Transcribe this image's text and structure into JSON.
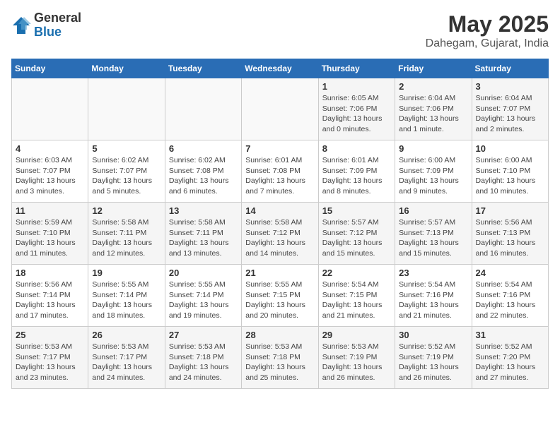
{
  "logo": {
    "general": "General",
    "blue": "Blue"
  },
  "header": {
    "month": "May 2025",
    "location": "Dahegam, Gujarat, India"
  },
  "weekdays": [
    "Sunday",
    "Monday",
    "Tuesday",
    "Wednesday",
    "Thursday",
    "Friday",
    "Saturday"
  ],
  "weeks": [
    [
      {
        "day": "",
        "info": ""
      },
      {
        "day": "",
        "info": ""
      },
      {
        "day": "",
        "info": ""
      },
      {
        "day": "",
        "info": ""
      },
      {
        "day": "1",
        "info": "Sunrise: 6:05 AM\nSunset: 7:06 PM\nDaylight: 13 hours\nand 0 minutes."
      },
      {
        "day": "2",
        "info": "Sunrise: 6:04 AM\nSunset: 7:06 PM\nDaylight: 13 hours\nand 1 minute."
      },
      {
        "day": "3",
        "info": "Sunrise: 6:04 AM\nSunset: 7:07 PM\nDaylight: 13 hours\nand 2 minutes."
      }
    ],
    [
      {
        "day": "4",
        "info": "Sunrise: 6:03 AM\nSunset: 7:07 PM\nDaylight: 13 hours\nand 3 minutes."
      },
      {
        "day": "5",
        "info": "Sunrise: 6:02 AM\nSunset: 7:07 PM\nDaylight: 13 hours\nand 5 minutes."
      },
      {
        "day": "6",
        "info": "Sunrise: 6:02 AM\nSunset: 7:08 PM\nDaylight: 13 hours\nand 6 minutes."
      },
      {
        "day": "7",
        "info": "Sunrise: 6:01 AM\nSunset: 7:08 PM\nDaylight: 13 hours\nand 7 minutes."
      },
      {
        "day": "8",
        "info": "Sunrise: 6:01 AM\nSunset: 7:09 PM\nDaylight: 13 hours\nand 8 minutes."
      },
      {
        "day": "9",
        "info": "Sunrise: 6:00 AM\nSunset: 7:09 PM\nDaylight: 13 hours\nand 9 minutes."
      },
      {
        "day": "10",
        "info": "Sunrise: 6:00 AM\nSunset: 7:10 PM\nDaylight: 13 hours\nand 10 minutes."
      }
    ],
    [
      {
        "day": "11",
        "info": "Sunrise: 5:59 AM\nSunset: 7:10 PM\nDaylight: 13 hours\nand 11 minutes."
      },
      {
        "day": "12",
        "info": "Sunrise: 5:58 AM\nSunset: 7:11 PM\nDaylight: 13 hours\nand 12 minutes."
      },
      {
        "day": "13",
        "info": "Sunrise: 5:58 AM\nSunset: 7:11 PM\nDaylight: 13 hours\nand 13 minutes."
      },
      {
        "day": "14",
        "info": "Sunrise: 5:58 AM\nSunset: 7:12 PM\nDaylight: 13 hours\nand 14 minutes."
      },
      {
        "day": "15",
        "info": "Sunrise: 5:57 AM\nSunset: 7:12 PM\nDaylight: 13 hours\nand 15 minutes."
      },
      {
        "day": "16",
        "info": "Sunrise: 5:57 AM\nSunset: 7:13 PM\nDaylight: 13 hours\nand 15 minutes."
      },
      {
        "day": "17",
        "info": "Sunrise: 5:56 AM\nSunset: 7:13 PM\nDaylight: 13 hours\nand 16 minutes."
      }
    ],
    [
      {
        "day": "18",
        "info": "Sunrise: 5:56 AM\nSunset: 7:14 PM\nDaylight: 13 hours\nand 17 minutes."
      },
      {
        "day": "19",
        "info": "Sunrise: 5:55 AM\nSunset: 7:14 PM\nDaylight: 13 hours\nand 18 minutes."
      },
      {
        "day": "20",
        "info": "Sunrise: 5:55 AM\nSunset: 7:14 PM\nDaylight: 13 hours\nand 19 minutes."
      },
      {
        "day": "21",
        "info": "Sunrise: 5:55 AM\nSunset: 7:15 PM\nDaylight: 13 hours\nand 20 minutes."
      },
      {
        "day": "22",
        "info": "Sunrise: 5:54 AM\nSunset: 7:15 PM\nDaylight: 13 hours\nand 21 minutes."
      },
      {
        "day": "23",
        "info": "Sunrise: 5:54 AM\nSunset: 7:16 PM\nDaylight: 13 hours\nand 21 minutes."
      },
      {
        "day": "24",
        "info": "Sunrise: 5:54 AM\nSunset: 7:16 PM\nDaylight: 13 hours\nand 22 minutes."
      }
    ],
    [
      {
        "day": "25",
        "info": "Sunrise: 5:53 AM\nSunset: 7:17 PM\nDaylight: 13 hours\nand 23 minutes."
      },
      {
        "day": "26",
        "info": "Sunrise: 5:53 AM\nSunset: 7:17 PM\nDaylight: 13 hours\nand 24 minutes."
      },
      {
        "day": "27",
        "info": "Sunrise: 5:53 AM\nSunset: 7:18 PM\nDaylight: 13 hours\nand 24 minutes."
      },
      {
        "day": "28",
        "info": "Sunrise: 5:53 AM\nSunset: 7:18 PM\nDaylight: 13 hours\nand 25 minutes."
      },
      {
        "day": "29",
        "info": "Sunrise: 5:53 AM\nSunset: 7:19 PM\nDaylight: 13 hours\nand 26 minutes."
      },
      {
        "day": "30",
        "info": "Sunrise: 5:52 AM\nSunset: 7:19 PM\nDaylight: 13 hours\nand 26 minutes."
      },
      {
        "day": "31",
        "info": "Sunrise: 5:52 AM\nSunset: 7:20 PM\nDaylight: 13 hours\nand 27 minutes."
      }
    ]
  ]
}
